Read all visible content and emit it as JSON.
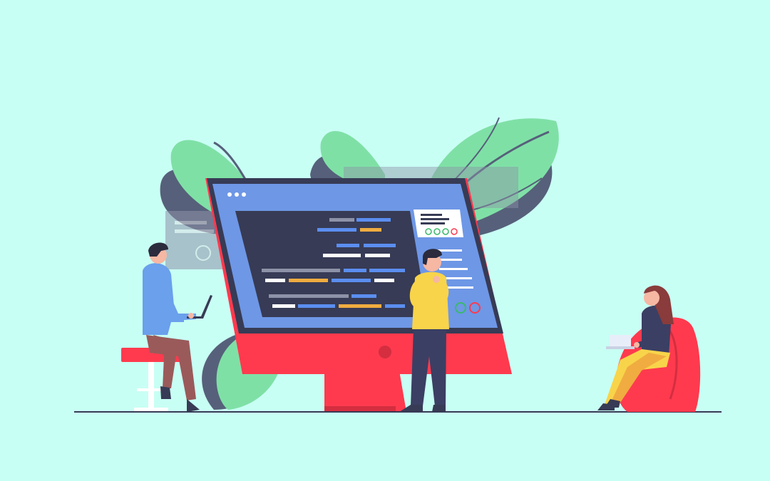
{
  "scene": {
    "background": "#c8fff4",
    "palette": {
      "leaf": "#7fe0a6",
      "leaf_dark": "#56607a",
      "monitor_red": "#ff3a4e",
      "monitor_bezel": "#373b55",
      "screen_blue": "#6e97e6",
      "code_bg": "#373b55",
      "code_blue": "#5b8ef0",
      "code_orange": "#f0ac40",
      "code_white": "#ffffff",
      "code_gray": "#8d92a8",
      "shirt_blue": "#6aa0ec",
      "shirt_yellow": "#f8d44a",
      "pants_navy": "#3b3f63",
      "pants_brown": "#9a5a5a",
      "beanbag_red": "#ff3a4e",
      "stool_red": "#ff3a4e",
      "ground": "#373b55"
    },
    "elements": [
      "leaf-left-icon",
      "leaf-center-icon",
      "leaf-right-icon",
      "monitor-icon",
      "code-editor-panel",
      "status-check-icons",
      "floating-window-icon",
      "person-on-stool-with-laptop",
      "person-standing-thinking",
      "woman-on-beanbag-with-laptop",
      "ground-line"
    ],
    "status_icons": [
      "check-icon",
      "check-icon",
      "check-icon",
      "alert-icon"
    ]
  }
}
